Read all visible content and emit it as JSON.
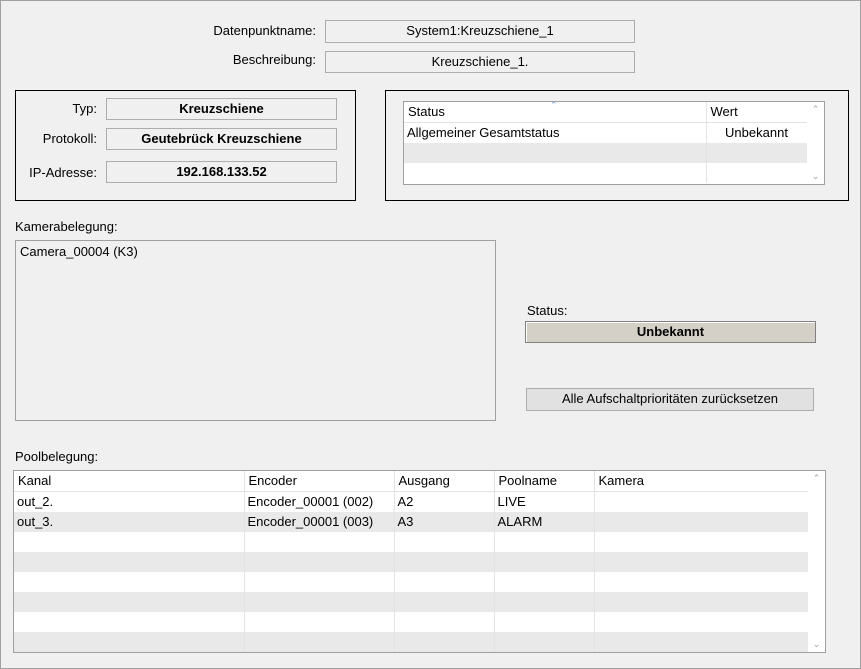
{
  "header": {
    "datapoint_label": "Datenpunktname:",
    "datapoint_value": "System1:Kreuzschiene_1",
    "description_label": "Beschreibung:",
    "description_value": "Kreuzschiene_1."
  },
  "info": {
    "type_label": "Typ:",
    "type_value": "Kreuzschiene",
    "protocol_label": "Protokoll:",
    "protocol_value": "Geutebrück Kreuzschiene",
    "ip_label": "IP-Adresse:",
    "ip_value": "192.168.133.52"
  },
  "status_table": {
    "headers": [
      "Status",
      "Wert"
    ],
    "rows": [
      [
        "Allgemeiner Gesamtstatus",
        "Unbekannt"
      ],
      [
        "",
        ""
      ],
      [
        "",
        ""
      ]
    ],
    "sort_icon": "sort-ascending-icon"
  },
  "camera": {
    "label": "Kamerabelegung:",
    "items": [
      "Camera_00004 (K3)"
    ]
  },
  "status_panel": {
    "label": "Status:",
    "value": "Unbekannt",
    "reset_button": "Alle Aufschaltprioritäten zurücksetzen"
  },
  "pool": {
    "label": "Poolbelegung:",
    "headers": [
      "Kanal",
      "Encoder",
      "Ausgang",
      "Poolname",
      "Kamera"
    ],
    "rows": [
      [
        "out_2.",
        "Encoder_00001  (002)",
        "A2",
        "LIVE",
        ""
      ],
      [
        "out_3.",
        "Encoder_00001  (003)",
        "A3",
        "ALARM",
        ""
      ],
      [
        "",
        "",
        "",
        "",
        ""
      ],
      [
        "",
        "",
        "",
        "",
        ""
      ],
      [
        "",
        "",
        "",
        "",
        ""
      ],
      [
        "",
        "",
        "",
        "",
        ""
      ],
      [
        "",
        "",
        "",
        "",
        ""
      ],
      [
        "",
        "",
        "",
        "",
        ""
      ]
    ]
  }
}
